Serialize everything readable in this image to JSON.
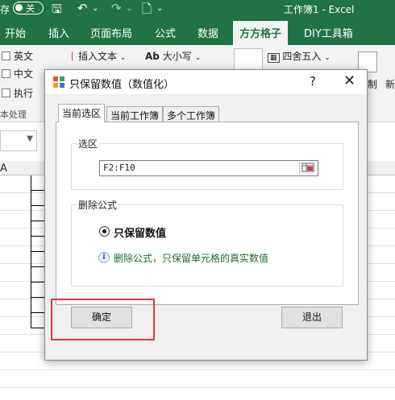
{
  "titlebar": {
    "autosave_label": "存",
    "toggle_label": "关",
    "document_title": "工作簿1  -  Excel"
  },
  "ribbon_tabs": [
    {
      "label": "开始"
    },
    {
      "label": "插入"
    },
    {
      "label": "页面布局"
    },
    {
      "label": "公式"
    },
    {
      "label": "数据"
    },
    {
      "label": "方方格子",
      "active": true
    },
    {
      "label": "DIY工具箱"
    }
  ],
  "ribbon": {
    "english_label": "英文",
    "chinese_label": "中文",
    "execute_label": "执行",
    "insert_text_label": "插入文本",
    "case_label": "大小写",
    "case_icon_text": "Ab",
    "round_label": "四舍五入",
    "group_label": "本处理",
    "right_label_1": "制",
    "right_label_2": "新"
  },
  "grid": {
    "column_a": "A"
  },
  "dialog": {
    "title": "只保留数值（数值化）",
    "help": "?",
    "close": "✕",
    "tabs": [
      {
        "label": "当前选区",
        "active": true
      },
      {
        "label": "当前工作簿"
      },
      {
        "label": "多个工作簿"
      }
    ],
    "selection_group_title": "选区",
    "range_value": "F2:F10",
    "delete_group_title": "删除公式",
    "radio_label": "只保留数值",
    "info_text": "删除公式，只保留单元格的真实数值",
    "ok_label": "确定",
    "exit_label": "退出"
  },
  "colors": {
    "excel_green": "#217346",
    "highlight_red": "#e0393e",
    "info_green": "#1c6b2e"
  }
}
